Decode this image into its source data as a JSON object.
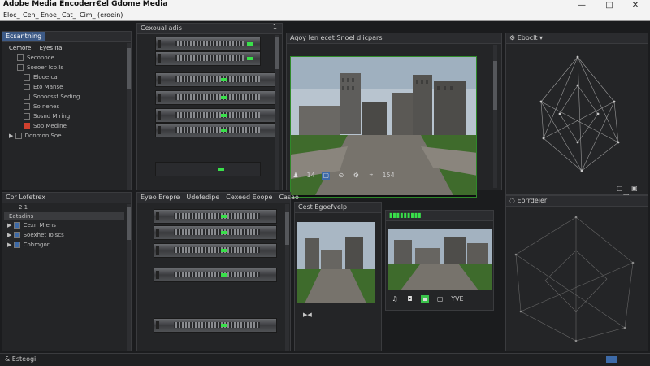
{
  "window": {
    "title": "Adobe Media Encoderr€el Gdome Media",
    "controls": [
      "—",
      "□",
      "✕"
    ]
  },
  "menu": [
    "Eloc_",
    "Cen_",
    "Enoe_",
    "Cat_",
    "Cim_",
    "(eroein)"
  ],
  "left_top": {
    "tab": "Ecsantning",
    "head_cols": [
      "Cemore",
      "Eyes Ita"
    ],
    "items": [
      "Seconoce",
      "Soeoer Icb.Is",
      "Elooe ca",
      "Eto Manse",
      "Sooocsst Seding",
      "So nenes",
      "Sosnd Miring",
      "Sop Medine",
      "Donmon Soe"
    ]
  },
  "center_top": {
    "tab": "Cexoual adis",
    "count": "1"
  },
  "preview": {
    "tab": "Aqoy Ien ecet Snoel dlicpars",
    "toolbar_num_a": "14",
    "toolbar_num_b": "154"
  },
  "right_top": {
    "tab": "Eboclt"
  },
  "left_bottom": {
    "tab": "Cor Lofetrex",
    "filter": "2 1",
    "group": "Eatadins",
    "items": [
      "Cexn Mlens",
      "Soexhet Ioiscs",
      "Cohmgor"
    ]
  },
  "center_bottom": {
    "tabs": [
      "Eyeo Erepre",
      "Udefedipe",
      "Cexeed Eoope",
      "Casao"
    ]
  },
  "mini_a": {
    "tab": "Cest Egoefvelp"
  },
  "mini_b": {
    "toolbar_label": "YVE"
  },
  "right_bottom": {
    "tab": "Eorrdeier"
  },
  "status": {
    "text": "& Esteogi"
  }
}
